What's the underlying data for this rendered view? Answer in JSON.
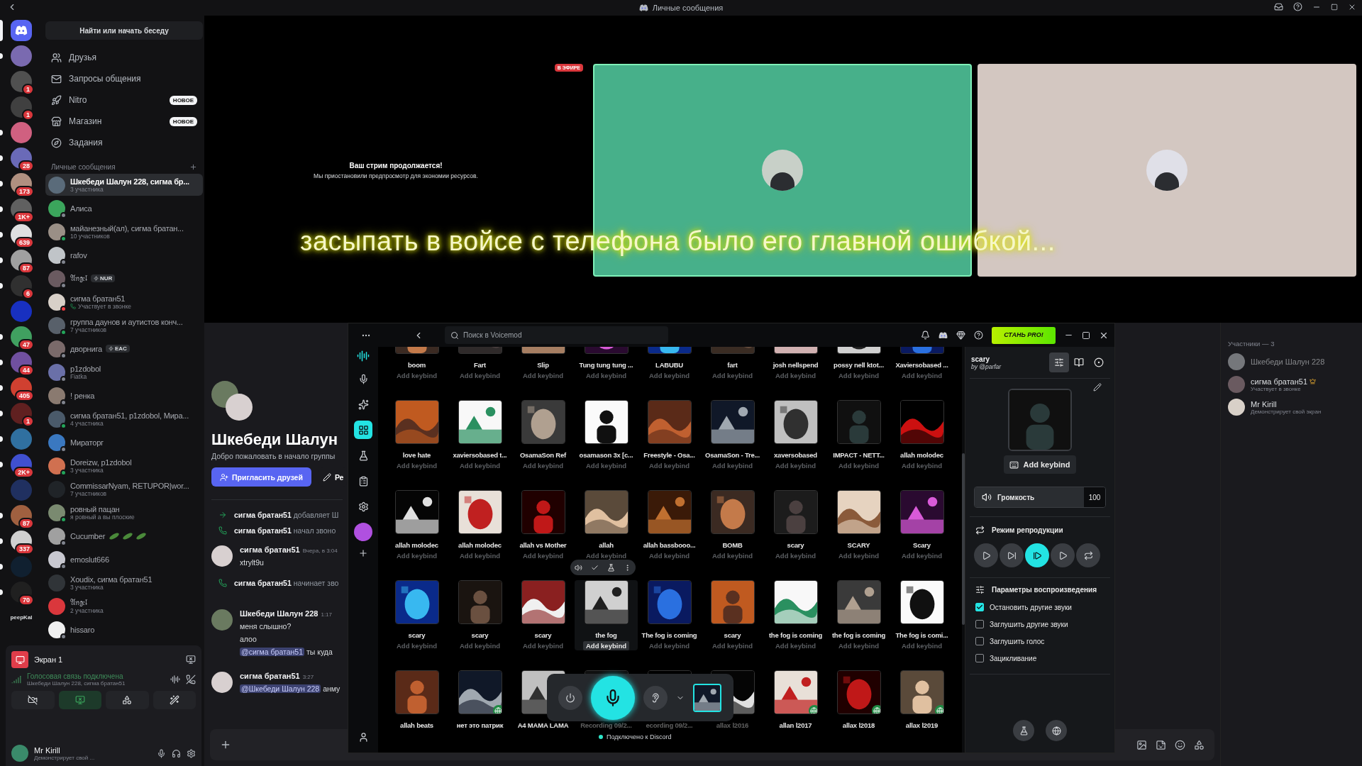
{
  "title_bar": {
    "title": "Личные сообщения"
  },
  "servers": [
    {
      "kind": "home",
      "selected": true,
      "unread": false
    },
    {
      "kind": "server",
      "selected": false,
      "unread": true
    },
    {
      "kind": "server",
      "badge": "1",
      "selected": false,
      "unread": false
    },
    {
      "kind": "server",
      "badge": "1",
      "selected": false,
      "unread": false
    },
    {
      "kind": "server",
      "selected": false,
      "unread": true
    },
    {
      "kind": "server",
      "badge": "28",
      "selected": false,
      "unread": true
    },
    {
      "kind": "server",
      "badge": "173",
      "selected": false,
      "unread": true
    },
    {
      "kind": "server",
      "badge": "1K+",
      "selected": false,
      "unread": true
    },
    {
      "kind": "server",
      "badge": "639",
      "selected": false,
      "unread": true
    },
    {
      "kind": "server",
      "badge": "87",
      "selected": false,
      "unread": true
    },
    {
      "kind": "server",
      "badge": "6",
      "selected": false,
      "unread": true
    },
    {
      "kind": "server",
      "selected": false,
      "unread": false
    },
    {
      "kind": "server",
      "badge": "47",
      "selected": false,
      "unread": true
    },
    {
      "kind": "server",
      "badge": "44",
      "selected": false,
      "unread": true
    },
    {
      "kind": "server",
      "badge": "405",
      "selected": false,
      "unread": true
    },
    {
      "kind": "server",
      "badge": "1",
      "selected": false,
      "unread": true
    },
    {
      "kind": "server",
      "selected": false,
      "unread": true
    },
    {
      "kind": "server",
      "badge": "2K+",
      "selected": false,
      "unread": true
    },
    {
      "kind": "server",
      "selected": false,
      "unread": false
    },
    {
      "kind": "server",
      "badge": "87",
      "selected": false,
      "unread": true
    },
    {
      "kind": "server",
      "badge": "337",
      "selected": false,
      "unread": true
    },
    {
      "kind": "server",
      "selected": false,
      "unread": true
    },
    {
      "kind": "server",
      "badge": "70",
      "selected": false,
      "unread": true
    },
    {
      "kind": "label",
      "text": "peepKal",
      "selected": false,
      "unread": false
    }
  ],
  "dm_sidebar": {
    "search": "Найти или начать беседу",
    "nav": [
      {
        "label": "Друзья"
      },
      {
        "label": "Запросы общения"
      },
      {
        "label": "Nitro",
        "badge": "НОВОЕ"
      },
      {
        "label": "Магазин",
        "badge": "НОВОЕ"
      },
      {
        "label": "Задания"
      }
    ],
    "section_title": "Личные сообщения",
    "conversations": [
      {
        "name": "Шкебеди Шалун 228, сигма бр...",
        "subtitle": {
          "kind": "members",
          "text": "3 участника"
        },
        "selected": true
      },
      {
        "name": "Алиса",
        "color": "#80848e",
        "selected": false
      },
      {
        "name": "майанезный(ал), сигма братан...",
        "subtitle": {
          "kind": "members",
          "text": "10 участников"
        },
        "color": "#23a55a",
        "selected": false
      },
      {
        "name": "rafov",
        "color": "#80848e",
        "selected": false
      },
      {
        "name": "𝔄𝔫𝔤𝔢𝔩",
        "tag": "NUR",
        "color": "#80848e",
        "selected": false
      },
      {
        "name": "сигма братан51",
        "subtitle": {
          "kind": "call",
          "text": "Участвует в звонке"
        },
        "color": "#f23f43",
        "selected": false
      },
      {
        "name": "группа даунов и аутистов конч...",
        "subtitle": {
          "kind": "members",
          "text": "7 участников"
        },
        "color": "#23a55a",
        "selected": false
      },
      {
        "name": "дворнига",
        "tag": "EAC",
        "color": "#80848e",
        "selected": false
      },
      {
        "name": "p1zdobol",
        "subtitle": {
          "kind": "status",
          "text": "Fiatka"
        },
        "color": "#80848e",
        "selected": false
      },
      {
        "name": "! ренка",
        "color": "#80848e",
        "selected": false
      },
      {
        "name": "сигма братан51, p1zdobol, Мира...",
        "subtitle": {
          "kind": "members",
          "text": "4 участника"
        },
        "color": "#23a55a",
        "selected": false
      },
      {
        "name": "Мираторг",
        "color": "#80848e",
        "selected": false
      },
      {
        "name": "Doreizw, p1zdobol",
        "subtitle": {
          "kind": "members",
          "text": "3 участника"
        },
        "color": "#23a55a",
        "selected": false
      },
      {
        "name": "CommissarNyam, RETUPOR|wor...",
        "subtitle": {
          "kind": "members",
          "text": "7 участников"
        },
        "selected": false
      },
      {
        "name": "ровный пацан",
        "subtitle": {
          "kind": "status",
          "text": "я ровный а вы плоские"
        },
        "color": "#23a55a",
        "selected": false
      },
      {
        "name": "Cucumber",
        "flair": true,
        "color": "#80848e",
        "selected": false
      },
      {
        "name": "emoslut666",
        "color": "#80848e",
        "selected": false
      },
      {
        "name": "Xoudix, сигма братан51",
        "subtitle": {
          "kind": "members",
          "text": "3 участника"
        },
        "selected": false
      },
      {
        "name": "𝔄𝔫𝔤𝔢𝔩",
        "subtitle": {
          "kind": "members",
          "text": "2 участника"
        },
        "selected": false
      },
      {
        "name": "hissaro",
        "color": "#80848e",
        "selected": false
      }
    ]
  },
  "voice_panel": {
    "stream_title": "Экран 1",
    "connection": "Голосовая связь подключена",
    "channel": "Шкебеди Шалун 228, сигма братан51",
    "controls": [
      {
        "selected": false
      },
      {
        "selected": true
      },
      {
        "selected": false
      },
      {
        "selected": false
      }
    ],
    "user": {
      "name": "Mr Kirill",
      "status": "Демонстрирует свой ..."
    }
  },
  "stage": {
    "live_badge": "В ЭФИРЕ",
    "paused_title": "Ваш стрим продолжается!",
    "paused_text": "Мы приостановили предпросмотр для экономии ресурсов.",
    "tiles": [
      {
        "color": "#47b08a",
        "speaking": true
      },
      {
        "color": "#d3c7c1",
        "speaking": false
      }
    ],
    "subtitle": "засыпать в войсе с телефона было его главной ошибкой..."
  },
  "chat": {
    "title": "Шкебеди Шалун",
    "welcome": "Добро пожаловать в начало группы",
    "invite": "Пригласить друзей",
    "edit": "Ре",
    "messages": [
      {
        "kind": "added",
        "author": "сигма братан51",
        "text": "добавляет Ш"
      },
      {
        "kind": "call",
        "author": "сигма братан51",
        "text": "начал звоно"
      },
      {
        "kind": "message",
        "author": "сигма братан51",
        "time": "Вчера, в 3:04",
        "lines": [
          {
            "text": "xtrylt9u"
          }
        ]
      },
      {
        "kind": "call",
        "author": "сигма братан51",
        "text": "начинает зво"
      },
      {
        "kind": "message",
        "author": "Шкебеди Шалун 228",
        "time": "1:17",
        "lines": [
          {
            "text": "меня слышно?"
          },
          {
            "text": "алоо"
          },
          {
            "mention": "@сигма братан51",
            "text": "ты куда"
          }
        ]
      },
      {
        "kind": "message",
        "author": "сигма братан51",
        "time": "3:27",
        "lines": [
          {
            "mention": "@Шкебеди Шалун 228",
            "text": "анму"
          }
        ]
      }
    ]
  },
  "members": {
    "title": "Участники — 3",
    "list": [
      {
        "name": "Шкебеди Шалун 228",
        "offline": true,
        "owner": false
      },
      {
        "name": "сигма братан51",
        "activity": "Участвует в звонке",
        "offline": false,
        "owner": true
      },
      {
        "name": "Mr Kirill",
        "activity": "Демонстрирует свой экран",
        "offline": false,
        "owner": false
      }
    ]
  },
  "voicemod": {
    "search": "Поиск в Voicemod",
    "pro": "СТАНЬ PRO!",
    "rail": [
      {
        "selected": false
      },
      {
        "selected": false
      },
      {
        "selected": true
      },
      {
        "selected": false
      },
      {
        "selected": false
      },
      {
        "selected": false
      }
    ],
    "sounds": [
      {
        "name": "boom",
        "keybind": "Add keybind"
      },
      {
        "name": "Fart",
        "keybind": "Add keybind"
      },
      {
        "name": "Slip",
        "keybind": "Add keybind"
      },
      {
        "name": "Tung tung tung ...",
        "keybind": "Add keybind"
      },
      {
        "name": "LABUBU",
        "keybind": "Add keybind"
      },
      {
        "name": "fart",
        "keybind": "Add keybind"
      },
      {
        "name": "josh nellspend",
        "keybind": "Add keybind"
      },
      {
        "name": "possy nell ktot...",
        "keybind": "Add keybind"
      },
      {
        "name": "Xaviersobased ...",
        "keybind": "Add keybind"
      },
      {
        "name": "love hate",
        "keybind": "Add keybind"
      },
      {
        "name": "xaviersobased t...",
        "keybind": "Add keybind"
      },
      {
        "name": "OsamaSon Ref",
        "keybind": "Add keybind"
      },
      {
        "name": "osamason 3x [c...",
        "keybind": "Add keybind"
      },
      {
        "name": "Freestyle - Osa...",
        "keybind": "Add keybind"
      },
      {
        "name": "OsamaSon - Tre...",
        "keybind": "Add keybind"
      },
      {
        "name": "xaversobased",
        "keybind": "Add keybind"
      },
      {
        "name": "IMPACT - NETT...",
        "keybind": "Add keybind"
      },
      {
        "name": "allah molodec",
        "keybind": "Add keybind"
      },
      {
        "name": "allah molodec",
        "keybind": "Add keybind"
      },
      {
        "name": "allah molodec",
        "keybind": "Add keybind"
      },
      {
        "name": "allah vs Mother",
        "keybind": "Add keybind"
      },
      {
        "name": "allah",
        "keybind": "Add keybind"
      },
      {
        "name": "allah bassbooo...",
        "keybind": "Add keybind"
      },
      {
        "name": "BOMB",
        "keybind": "Add keybind"
      },
      {
        "name": "scary",
        "keybind": "Add keybind"
      },
      {
        "name": "SCARY",
        "keybind": "Add keybind"
      },
      {
        "name": "Scary",
        "keybind": "Add keybind"
      },
      {
        "name": "scary",
        "keybind": "Add keybind"
      },
      {
        "name": "scary",
        "keybind": "Add keybind"
      },
      {
        "name": "scary",
        "keybind": "Add keybind"
      },
      {
        "name": "the fog",
        "keybind": "Add keybind",
        "hovered": true
      },
      {
        "name": "The fog is coming",
        "keybind": "Add keybind"
      },
      {
        "name": "scary",
        "keybind": "Add keybind"
      },
      {
        "name": "the fog is coming",
        "keybind": "Add keybind"
      },
      {
        "name": "the fog is coming",
        "keybind": "Add keybind"
      },
      {
        "name": "The fog is comi...",
        "keybind": "Add keybind"
      },
      {
        "name": "allah beats"
      },
      {
        "name": "нет это патрик",
        "shared": true
      },
      {
        "name": "A4 MAMA LAMA"
      },
      {
        "name": "Recording 09/2..."
      },
      {
        "name": "ecording 09/2..."
      },
      {
        "name": "allax l2016"
      },
      {
        "name": "allan l2017",
        "shared": true
      },
      {
        "name": "allax l2018",
        "shared": true
      },
      {
        "name": "allax l2019",
        "shared": true
      }
    ],
    "connected": "Подключено к Discord",
    "detail": {
      "title": "scary",
      "author": "by @parfar",
      "tabs": [
        {
          "selected": true
        },
        {
          "selected": false
        },
        {
          "selected": false
        }
      ],
      "keybind": "Add keybind",
      "volume_label": "Громкость",
      "volume": "100",
      "mode_label": "Режим репродукции",
      "modes": [
        {
          "selected": false
        },
        {
          "selected": false
        },
        {
          "selected": true
        },
        {
          "selected": false
        },
        {
          "selected": false
        }
      ],
      "options_label": "Параметры воспроизведения",
      "options": [
        {
          "label": "Остановить другие звуки",
          "checked": true
        },
        {
          "label": "Заглушить другие звуки",
          "checked": false
        },
        {
          "label": "Заглушить голос",
          "checked": false
        },
        {
          "label": "Зацикливание",
          "checked": false
        }
      ]
    }
  }
}
